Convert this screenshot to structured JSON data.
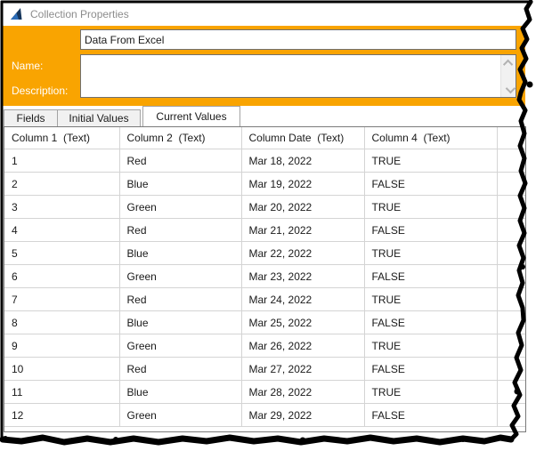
{
  "window": {
    "title": "Collection Properties"
  },
  "form": {
    "name_label": "Name:",
    "name_value": "Data From Excel",
    "description_label": "Description:",
    "description_value": ""
  },
  "tabs": [
    {
      "label": "Fields",
      "active": false
    },
    {
      "label": "Initial Values",
      "active": false
    },
    {
      "label": "Current Values",
      "active": true
    }
  ],
  "table": {
    "columns": [
      "Column 1  (Text)",
      "Column 2  (Text)",
      "Column Date  (Text)",
      "Column 4  (Text)"
    ],
    "rows": [
      [
        "1",
        "Red",
        "Mar 18, 2022",
        "TRUE"
      ],
      [
        "2",
        "Blue",
        "Mar 19, 2022",
        "FALSE"
      ],
      [
        "3",
        "Green",
        "Mar 20, 2022",
        "TRUE"
      ],
      [
        "4",
        "Red",
        "Mar 21, 2022",
        "FALSE"
      ],
      [
        "5",
        "Blue",
        "Mar 22, 2022",
        "TRUE"
      ],
      [
        "6",
        "Green",
        "Mar 23, 2022",
        "FALSE"
      ],
      [
        "7",
        "Red",
        "Mar 24, 2022",
        "TRUE"
      ],
      [
        "8",
        "Blue",
        "Mar 25, 2022",
        "FALSE"
      ],
      [
        "9",
        "Green",
        "Mar 26, 2022",
        "TRUE"
      ],
      [
        "10",
        "Red",
        "Mar 27, 2022",
        "FALSE"
      ],
      [
        "11",
        "Blue",
        "Mar 28, 2022",
        "TRUE"
      ],
      [
        "12",
        "Green",
        "Mar 29, 2022",
        "FALSE"
      ]
    ]
  },
  "icons": {
    "app_icon": "collection-arrow-icon",
    "scroll_up": "chevron-up",
    "scroll_down": "chevron-down"
  },
  "colors": {
    "accent_orange": "#F9A401",
    "title_text": "#8C8C8C",
    "grid_line": "#D4D4D4",
    "table_border": "#7A7A7A",
    "tab_border": "#A3A3A3",
    "torn_edge": "#000000",
    "icon_blue_dark": "#16365C",
    "icon_blue_light": "#2B6CB8"
  }
}
